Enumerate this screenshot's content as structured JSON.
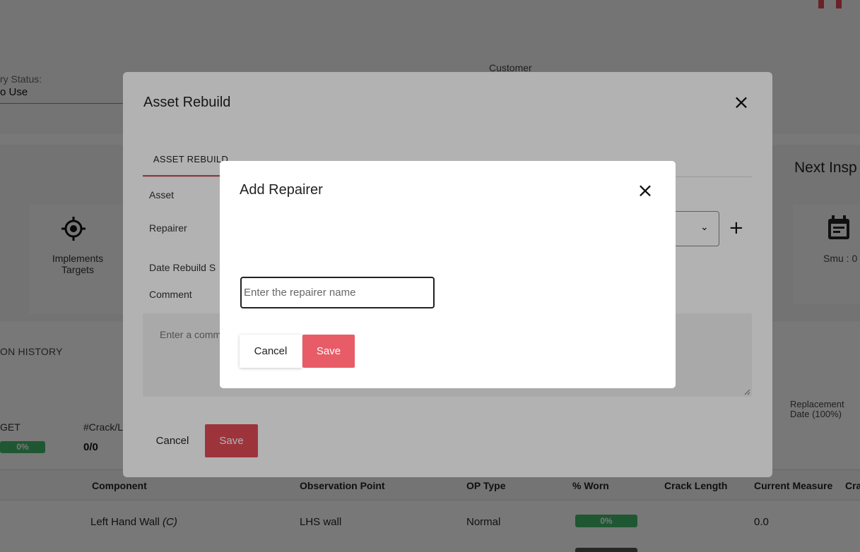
{
  "background": {
    "status_label": "ry Status:",
    "status_value": "o Use",
    "customer_label": "Customer",
    "implements_targets_label": "Implements\nTargets",
    "next_inspection_title": "Next Insp",
    "smu_label": "Smu : 0",
    "history_tab_label": "ON HISTORY",
    "get_label": "GET",
    "get_value": "0%",
    "crack_label": "#Crack/L",
    "crack_value": "0/0",
    "replacement_label": "Replacement\nDate (100%)",
    "table": {
      "columns": [
        "Component",
        "Observation Point",
        "OP Type",
        "% Worn",
        "Crack Length",
        "Current Measure",
        "Cra"
      ],
      "rows": [
        {
          "component": "Left Hand Wall",
          "component_suffix": "(C)",
          "observation_point": "LHS wall",
          "op_type": "Normal",
          "worn": "0%",
          "current_measure": "0.0"
        }
      ]
    },
    "accent_color": "#e14b57",
    "worn_color": "#43b96a"
  },
  "asset_rebuild_modal": {
    "title": "Asset Rebuild",
    "tab_label": "ASSET REBUILD",
    "fields": {
      "asset_label": "Asset",
      "repairer_label": "Repairer",
      "date_label": "Date Rebuild S",
      "comment_label": "Comment"
    },
    "comment_placeholder": "Enter a comment",
    "cancel_label": "Cancel",
    "save_label": "Save",
    "plus_label": "+"
  },
  "add_repairer_modal": {
    "title": "Add Repairer",
    "input_placeholder": "Enter the repairer name",
    "input_value": "",
    "cancel_label": "Cancel",
    "save_label": "Save"
  }
}
